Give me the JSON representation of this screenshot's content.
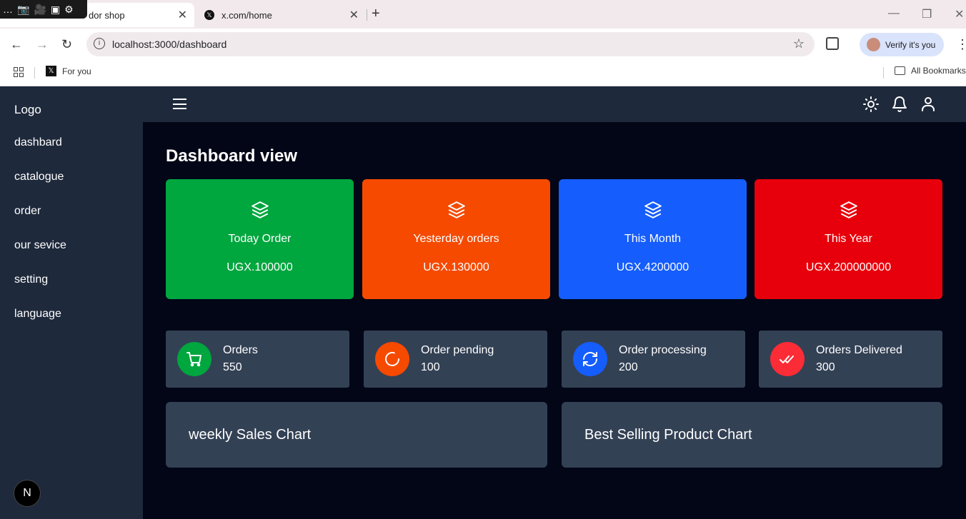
{
  "browser": {
    "active_tab_title": "dor shop",
    "second_tab_title": "x.com/home",
    "url": "localhost:3000/dashboard",
    "verify_label": "Verify it's you",
    "bookmark_foryou": "For you",
    "bookmark_all": "All Bookmarks"
  },
  "sidebar": {
    "logo": "Logo",
    "items": [
      {
        "label": "dashbard"
      },
      {
        "label": "catalogue"
      },
      {
        "label": "order"
      },
      {
        "label": "our sevice"
      },
      {
        "label": "setting"
      },
      {
        "label": "language"
      }
    ],
    "badge": "N"
  },
  "main": {
    "title": "Dashboard view",
    "stat_cards": [
      {
        "label": "Today Order",
        "value": "UGX.100000",
        "color": "#00a63e"
      },
      {
        "label": "Yesterday orders",
        "value": "UGX.130000",
        "color": "#f54a00"
      },
      {
        "label": "This Month",
        "value": "UGX.4200000",
        "color": "#155dfc"
      },
      {
        "label": "This Year",
        "value": "UGX.200000000",
        "color": "#e7000b"
      }
    ],
    "count_cards": [
      {
        "label": "Orders",
        "value": "550",
        "icon": "cart-icon",
        "color": "#00a63e"
      },
      {
        "label": "Order pending",
        "value": "100",
        "icon": "spinner-icon",
        "color": "#f54a00"
      },
      {
        "label": "Order processing",
        "value": "200",
        "icon": "refresh-icon",
        "color": "#155dfc"
      },
      {
        "label": "Orders Delivered",
        "value": "300",
        "icon": "check-double-icon",
        "color": "#fb2c36"
      }
    ],
    "charts": [
      {
        "title": "weekly Sales Chart"
      },
      {
        "title": "Best Selling Product Chart"
      }
    ]
  }
}
